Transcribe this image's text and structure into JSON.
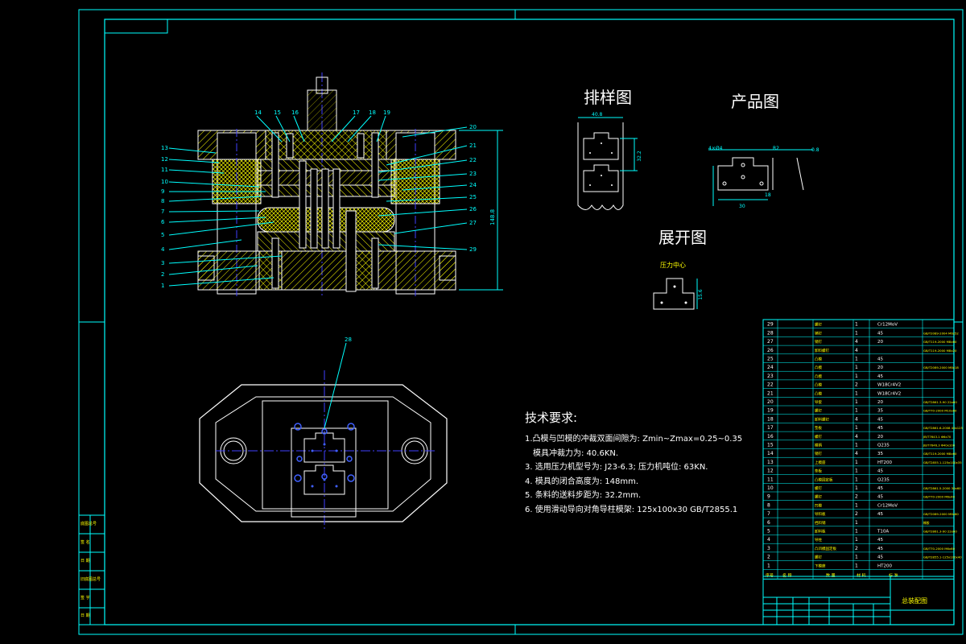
{
  "titles": {
    "layout": "排样图",
    "product": "产品图",
    "unfold": "展开图",
    "press_center": "压力中心"
  },
  "assembly_callouts_left": [
    "13",
    "12",
    "11",
    "10",
    "9",
    "8",
    "7",
    "6",
    "5",
    "4",
    "3",
    "2",
    "1"
  ],
  "assembly_callouts_top": [
    "14",
    "15",
    "16",
    "17",
    "18",
    "19"
  ],
  "assembly_callouts_right": [
    "20",
    "21",
    "22",
    "23",
    "24",
    "25",
    "26",
    "27",
    "29"
  ],
  "plan_callout": "28",
  "dimensions": {
    "die_height": "148.8",
    "strip_width": "40.8",
    "pitch": "32.2",
    "pitch2": "32.2",
    "product_hole": "4×Ø4",
    "product_width": "30",
    "product_r": "R2",
    "product_side": "18",
    "product_b": "6",
    "product_c": "2",
    "product_t": "0.8",
    "unfold_h": "15.6"
  },
  "tech": {
    "heading": "技术要求:",
    "lines": [
      "1.凸模与凹模的冲裁双面间隙为: Zmin~Zmax=0.25~0.35",
      "模具冲裁力为: 40.6KN.",
      "3. 选用压力机型号为: J23-6.3; 压力机吨位: 63KN.",
      "4. 模具的闭合高度为: 148mm.",
      "5. 条料的送料步距为: 32.2mm.",
      "6. 使用滑动导向对角导柱模架: 125x100x30   GB/T2855.1"
    ]
  },
  "side_block": [
    "底图总号",
    "签 名",
    "日 期",
    "旧底图总号",
    "签 字",
    "日 期"
  ],
  "bom": [
    {
      "no": "29",
      "name": "螺钉",
      "qty": "1",
      "mat": "Cr12MoV",
      "std": ""
    },
    {
      "no": "28",
      "name": "销钉",
      "qty": "1",
      "mat": "45",
      "std": "GB/T2089-2004 M6x52"
    },
    {
      "no": "27",
      "name": "销钉",
      "qty": "4",
      "mat": "20",
      "std": "GB/T119-2000 M8x60"
    },
    {
      "no": "26",
      "name": "卸料螺钉",
      "qty": "4",
      "mat": "",
      "std": "GB/T119-2000 M8x20"
    },
    {
      "no": "25",
      "name": "凸模",
      "qty": "1",
      "mat": "45",
      "std": ""
    },
    {
      "no": "24",
      "name": "凸模",
      "qty": "1",
      "mat": "20",
      "std": "GB/T2089-2000 M8x18"
    },
    {
      "no": "23",
      "name": "凸模",
      "qty": "1",
      "mat": "45",
      "std": ""
    },
    {
      "no": "22",
      "name": "凸模",
      "qty": "2",
      "mat": "W18Cr4V2",
      "std": ""
    },
    {
      "no": "21",
      "name": "凸模",
      "qty": "1",
      "mat": "W18Cr4V2",
      "std": ""
    },
    {
      "no": "20",
      "name": "导套",
      "qty": "1",
      "mat": "20",
      "std": "GB/T2861.3-90 22x60"
    },
    {
      "no": "19",
      "name": "螺钉",
      "qty": "1",
      "mat": "35",
      "std": "GB/T70-2000 M10x60"
    },
    {
      "no": "18",
      "name": "卸料螺钉",
      "qty": "4",
      "mat": "45",
      "std": ""
    },
    {
      "no": "17",
      "name": "垫板",
      "qty": "1",
      "mat": "45",
      "std": "GB/T2861.6-2008 40x125"
    },
    {
      "no": "16",
      "name": "螺钉",
      "qty": "4",
      "mat": "20",
      "std": "JB/T7643.1 Φ6x70"
    },
    {
      "no": "15",
      "name": "模柄",
      "qty": "1",
      "mat": "Q235",
      "std": "JB/T7646.3 Φ40x100"
    },
    {
      "no": "14",
      "name": "销钉",
      "qty": "4",
      "mat": "35",
      "std": "GB/T119-2000 M8x60"
    },
    {
      "no": "13",
      "name": "上模座",
      "qty": "1",
      "mat": "HT200",
      "std": "GB/T2855.1-125x100x35"
    },
    {
      "no": "12",
      "name": "垫板",
      "qty": "1",
      "mat": "45",
      "std": ""
    },
    {
      "no": "11",
      "name": "凸模固定板",
      "qty": "1",
      "mat": "Q235",
      "std": ""
    },
    {
      "no": "10",
      "name": "螺钉",
      "qty": "1",
      "mat": "45",
      "std": "GB/T2861.5-2000 30x60"
    },
    {
      "no": "9",
      "name": "螺钉",
      "qty": "2",
      "mat": "45",
      "std": "GB/T70-2000 M6x40"
    },
    {
      "no": "8",
      "name": "凹模",
      "qty": "1",
      "mat": "Cr12MoV",
      "std": ""
    },
    {
      "no": "7",
      "name": "导料板",
      "qty": "2",
      "mat": "45",
      "std": "GB/T2089-2000 M8x80"
    },
    {
      "no": "6",
      "name": "挡料销",
      "qty": "1",
      "mat": "",
      "std": "橡胶"
    },
    {
      "no": "5",
      "name": "卸料板",
      "qty": "1",
      "mat": "T10A",
      "std": "GB/T2861.3-90 22x60"
    },
    {
      "no": "4",
      "name": "导柱",
      "qty": "1",
      "mat": "45",
      "std": ""
    },
    {
      "no": "3",
      "name": "凸凹模固定板",
      "qty": "2",
      "mat": "45",
      "std": "GB/T70-2000 M6x60"
    },
    {
      "no": "2",
      "name": "螺钉",
      "qty": "1",
      "mat": "45",
      "std": "GB/T2855.1-125x100x40"
    },
    {
      "no": "1",
      "name": "下模座",
      "qty": "1",
      "mat": "HT200",
      "std": ""
    }
  ],
  "bom_header": [
    "序号",
    "名 称",
    "数 量",
    "材 料",
    "标 准"
  ],
  "drawing_title": "总装配图",
  "colors": {
    "background": "#000000",
    "frame": "#00ffff",
    "hatch": "#ffff00",
    "dims": "#00ffff",
    "parts": "#ffffff",
    "center": "#4040ff",
    "text": "#ffffff"
  }
}
